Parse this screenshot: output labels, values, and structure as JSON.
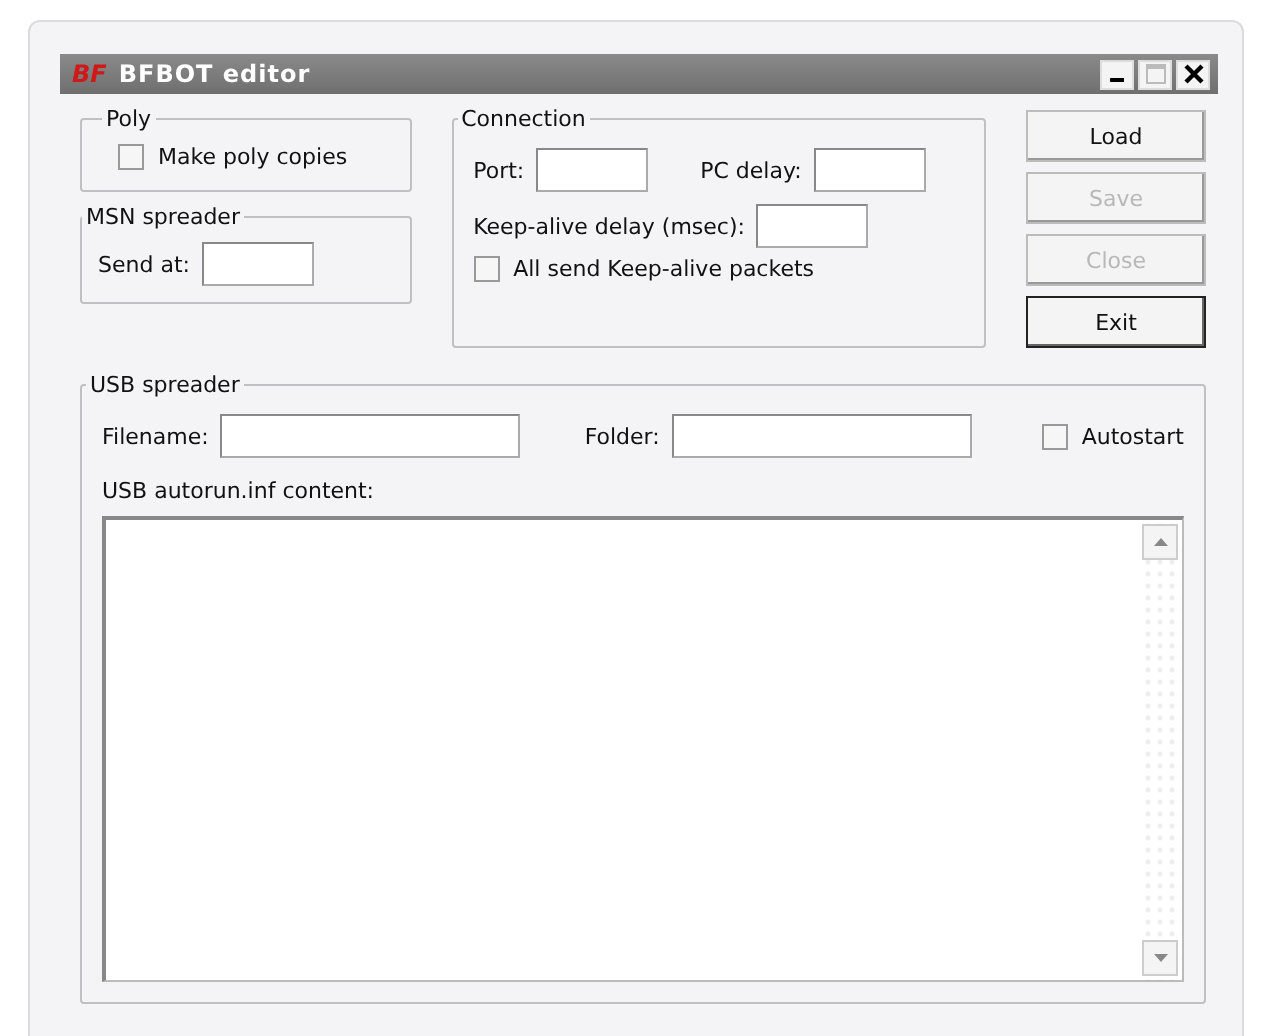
{
  "window": {
    "logo": "BF",
    "title": "BFBOT editor"
  },
  "poly": {
    "title": "Poly",
    "checkbox": {
      "label": "Make poly copies",
      "checked": false
    }
  },
  "msn_spreader": {
    "title": "MSN spreader",
    "send_at": {
      "label": "Send at:"
    }
  },
  "connection": {
    "title": "Connection",
    "port": {
      "label": "Port:"
    },
    "pc_delay": {
      "label": "PC delay:"
    },
    "keepalive_delay": {
      "label": "Keep-alive delay (msec):"
    },
    "checkbox": {
      "label": "All send Keep-alive packets",
      "checked": false
    }
  },
  "buttons": [
    {
      "label": "Load",
      "disabled": false,
      "default": false
    },
    {
      "label": "Save",
      "disabled": true,
      "default": false
    },
    {
      "label": "Close",
      "disabled": true,
      "default": false
    },
    {
      "label": "Exit",
      "disabled": false,
      "default": true
    }
  ],
  "usb_spreader": {
    "title": "USB spreader",
    "filename": {
      "label": "Filename:"
    },
    "folder": {
      "label": "Folder:"
    },
    "autostart": {
      "label": "Autostart",
      "checked": false
    },
    "content": {
      "label": "USB autorun.inf content:"
    }
  }
}
